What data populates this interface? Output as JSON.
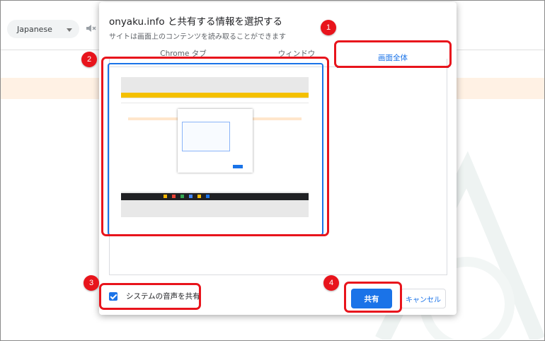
{
  "background": {
    "language_select": {
      "value": "Japanese"
    },
    "speaker_icon": "speaker-muted-icon"
  },
  "dialog": {
    "title": "onyaku.info と共有する情報を選択する",
    "subtitle": "サイトは画面上のコンテンツを読み取ることができます",
    "tabs": [
      {
        "label": "Chrome タブ"
      },
      {
        "label": "ウィンドウ"
      },
      {
        "label": "画面全体"
      }
    ],
    "active_tab": "画面全体",
    "share_audio_label": "システムの音声を共有",
    "share_audio_checked": true,
    "share_button": "共有",
    "cancel_button": "キャンセル",
    "accent_color": "#1a73e8"
  },
  "annotations": {
    "color": "#e8141c",
    "markers": [
      "1",
      "2",
      "3",
      "4"
    ]
  }
}
